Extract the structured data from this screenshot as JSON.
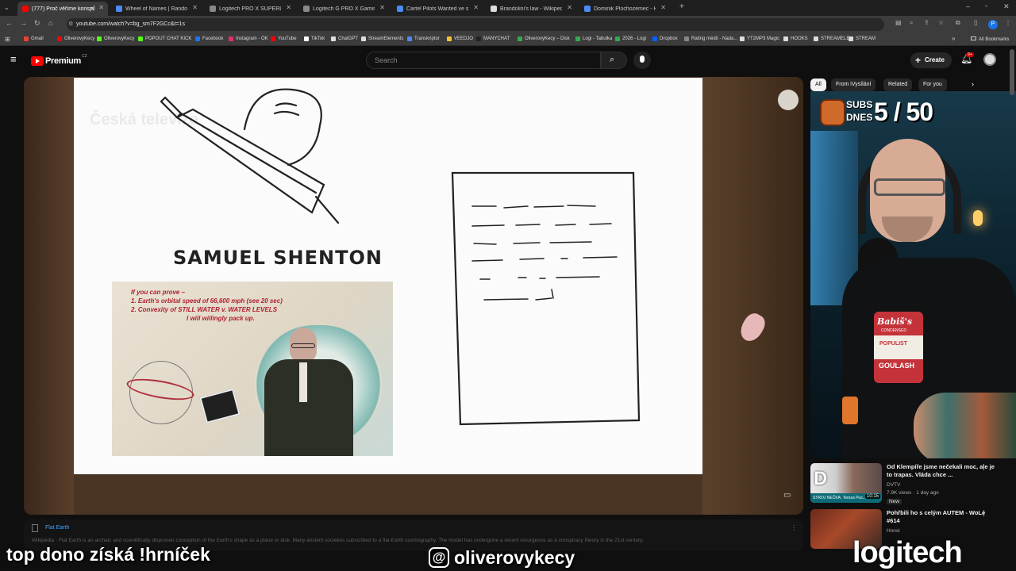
{
  "browser": {
    "tabs": [
      {
        "label": "(777) Proč věříme konspira...",
        "color": "#ff0000",
        "active": true
      },
      {
        "label": "Wheel of Names | Random nam...",
        "color": "#4c8bf5",
        "active": false
      },
      {
        "label": "Logitech PRO X SUPERLIGHT 2...",
        "color": "#888888",
        "active": false
      },
      {
        "label": "Logitech G PRO X Gaming Hea...",
        "color": "#888888",
        "active": false
      },
      {
        "label": "Cartel Pilots Wanted ve službě...",
        "color": "#4c8bf5",
        "active": false
      },
      {
        "label": "Brandolini's law - Wikipedia",
        "color": "#dddddd",
        "active": false
      },
      {
        "label": "Dominik Plochozemec - Hledat...",
        "color": "#4c8bf5",
        "active": false
      }
    ],
    "url": "youtube.com/watch?v=bg_sm7F2GCc&t=1s",
    "bookmarks": [
      {
        "label": "Gmail",
        "color": "#ea4335"
      },
      {
        "label": "OliverovyKecy",
        "color": "#ff0000"
      },
      {
        "label": "OliverovyKecy",
        "color": "#53fc18"
      },
      {
        "label": "POPOUT CHAT KICK",
        "color": "#53fc18"
      },
      {
        "label": "Facebook",
        "color": "#1877f2"
      },
      {
        "label": "Instagram - OK",
        "color": "#e1306c"
      },
      {
        "label": "YouTube",
        "color": "#ff0000"
      },
      {
        "label": "TikTok",
        "color": "#ffffff"
      },
      {
        "label": "ChatGPT",
        "color": "#dddddd"
      },
      {
        "label": "StreamElements",
        "color": "#dddddd"
      },
      {
        "label": "Transkriptor",
        "color": "#4c8bf5"
      },
      {
        "label": "VEEDJO",
        "color": "#f4c430"
      },
      {
        "label": "MANYCHAT",
        "color": "#222222"
      },
      {
        "label": "OliverovyKecy – Disk",
        "color": "#34a853"
      },
      {
        "label": "Logi - Tabulka",
        "color": "#34a853"
      },
      {
        "label": "2026 - Logi",
        "color": "#34a853"
      },
      {
        "label": "Dropbox",
        "color": "#0061ff"
      },
      {
        "label": "Rating médií - Nada...",
        "color": "#888888"
      },
      {
        "label": "YT2MP3 Magic",
        "color": "#dddddd"
      },
      {
        "label": "HOOKS",
        "color": "#dddddd"
      },
      {
        "label": "STREAMELE",
        "color": "#dddddd"
      },
      {
        "label": "STREAM",
        "color": "#dddddd"
      }
    ],
    "all_bookmarks": "All Bookmarks"
  },
  "youtube": {
    "logo": "Premium",
    "region": "CZ",
    "search_placeholder": "Search",
    "create_label": "Create",
    "notif_badge": "9+",
    "chips": [
      "All",
      "From iVysílání",
      "Related",
      "For you"
    ]
  },
  "video": {
    "watermark": "Česká televize",
    "drawn_name": "SAMUEL SHENTON",
    "poster_lines": [
      "If you can prove –",
      "1. Earth's orbital speed of 66,600 mph (see 20 sec)",
      "2. Convexity of STILL WATER v. WATER LEVELS",
      "I will willingly pack up."
    ]
  },
  "info_panel": {
    "title": "Flat Earth",
    "text": "Wikipedia · Flat Earth is an archaic and scientifically disproven conception of the Earth's shape as a plane or disk. Many ancient societies subscribed to a flat-Earth cosmography. The model has undergone a recent resurgence as a conspiracy theory in the 21st century."
  },
  "stream_overlay": {
    "subs_label_top": "SUBS",
    "subs_label_bottom": "DNES",
    "subs_count": "5 / 50",
    "shirt_brand": "Babiš's",
    "shirt_sub": "CONDENSED",
    "shirt_line1": "POPULIST",
    "shirt_line2": "GOULASH",
    "bottom_text": "top dono získá !hrníček",
    "threads_handle": "oliverovykecy",
    "sponsor": "logitech"
  },
  "recommendations": [
    {
      "title": "Od Klempíře jsme nečekali moc, ale je to trapas. Vláda chce ...",
      "channel": "DVTV",
      "meta": "7.9K views · 1 day ago",
      "badge": "New",
      "duration": "10:15",
      "thumb_caption": "STROJ NEČKA: Tereza Pos..."
    },
    {
      "title": "Pohřbili ho s celým AUTEM - WoLe #614",
      "channel": "Honsi",
      "meta": "",
      "badge": "",
      "duration": "",
      "thumb_caption": ""
    }
  ],
  "colors": {
    "yt_red": "#ff0000",
    "notif_red": "#cc0000",
    "cam_bg": "#0c1c26",
    "desk_wood": "#4a3424"
  }
}
